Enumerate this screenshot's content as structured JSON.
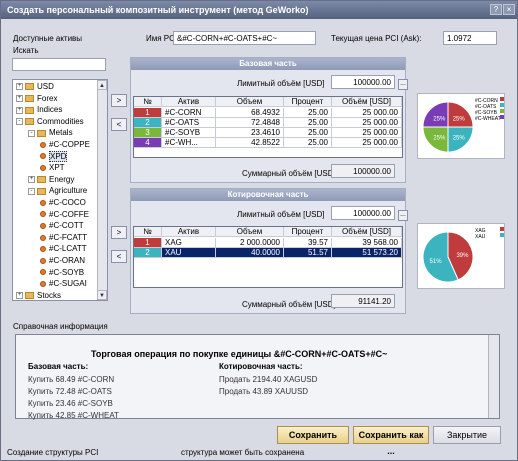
{
  "window": {
    "title": "Создать персональный композитный инструмент (метод GeWorko)"
  },
  "left": {
    "available_label": "Доступные активы",
    "search_label": "Искать",
    "search_value": "",
    "tree": [
      {
        "label": "USD",
        "level": 0,
        "kind": "folder",
        "exp": "+"
      },
      {
        "label": "Forex",
        "level": 0,
        "kind": "folder",
        "exp": "+"
      },
      {
        "label": "Indices",
        "level": 0,
        "kind": "folder",
        "exp": "+"
      },
      {
        "label": "Commodities",
        "level": 0,
        "kind": "folder",
        "exp": "-"
      },
      {
        "label": "Metals",
        "level": 1,
        "kind": "folder",
        "exp": "-"
      },
      {
        "label": "#C-COPPE",
        "level": 2,
        "kind": "item"
      },
      {
        "label": "XPD",
        "level": 2,
        "kind": "item",
        "selected": true
      },
      {
        "label": "XPT",
        "level": 2,
        "kind": "item"
      },
      {
        "label": "Energy",
        "level": 1,
        "kind": "folder",
        "exp": "+"
      },
      {
        "label": "Agriculture",
        "level": 1,
        "kind": "folder",
        "exp": "-"
      },
      {
        "label": "#C-COCO",
        "level": 2,
        "kind": "item"
      },
      {
        "label": "#C-COFFE",
        "level": 2,
        "kind": "item"
      },
      {
        "label": "#C-COTT",
        "level": 2,
        "kind": "item"
      },
      {
        "label": "#C-FCATT",
        "level": 2,
        "kind": "item"
      },
      {
        "label": "#C-LCATT",
        "level": 2,
        "kind": "item"
      },
      {
        "label": "#C-ORAN",
        "level": 2,
        "kind": "item"
      },
      {
        "label": "#C-SOYB",
        "level": 2,
        "kind": "item"
      },
      {
        "label": "#C-SUGAI",
        "level": 2,
        "kind": "item"
      },
      {
        "label": "Stocks",
        "level": 0,
        "kind": "folder",
        "exp": "+"
      }
    ]
  },
  "pci": {
    "name_label": "Имя PCI:",
    "name_value": "&#C-CORN+#C-OATS+#C~",
    "price_label": "Текущая цена PCI (Ask):",
    "price_value": "1.0972"
  },
  "base": {
    "title": "Базовая часть",
    "limit_label": "Лимитный объём [USD]",
    "limit_value": "100000.00",
    "sum_label": "Суммарный объём [USD]",
    "sum_value": "100000.00",
    "headers": [
      "№",
      "Актив",
      "Объем",
      "Процент",
      "Объём [USD]"
    ],
    "rows": [
      {
        "n": "1",
        "asset": "#C-CORN",
        "vol": "68.4932",
        "pct": "25.00",
        "usd": "25 000.00",
        "color": "#c03c3c"
      },
      {
        "n": "2",
        "asset": "#C-OATS",
        "vol": "72.4848",
        "pct": "25.00",
        "usd": "25 000.00",
        "color": "#3cb4c0"
      },
      {
        "n": "3",
        "asset": "#C-SOYB",
        "vol": "23.4610",
        "pct": "25.00",
        "usd": "25 000.00",
        "color": "#7ab83c"
      },
      {
        "n": "4",
        "asset": "#C-WH...",
        "vol": "42.8522",
        "pct": "25.00",
        "usd": "25 000.00",
        "color": "#7a3cb4"
      }
    ],
    "pie": {
      "legend": [
        "#C-CORN",
        "#C-OATS",
        "#C-SOYB",
        "#C-WHEAT"
      ],
      "values": [
        25,
        25,
        25,
        25
      ],
      "labels": [
        "25%",
        "25%",
        "25%",
        "25%"
      ]
    }
  },
  "quote": {
    "title": "Котировочная часть",
    "limit_label": "Лимитный объём [USD]",
    "limit_value": "100000.00",
    "sum_label": "Суммарный объём [USD]",
    "sum_value": "91141.20",
    "headers": [
      "№",
      "Актив",
      "Объем",
      "Процент",
      "Объём [USD]"
    ],
    "rows": [
      {
        "n": "1",
        "asset": "XAG",
        "vol": "2 000.0000",
        "pct": "39.57",
        "usd": "39 568.00",
        "color": "#c03c3c"
      },
      {
        "n": "2",
        "asset": "XAU",
        "vol": "40.0000",
        "pct": "51.57",
        "usd": "51 573.20",
        "color": "#3cb4c0",
        "selected": true
      }
    ],
    "pie": {
      "legend": [
        "XAG",
        "XAU"
      ],
      "values": [
        39,
        51
      ],
      "labels": [
        "39%",
        "51%"
      ]
    }
  },
  "info": {
    "label": "Справочная информация",
    "heading": "Торговая операция по покупке единицы &#C-CORN+#C-OATS+#C~",
    "base_title": "Базовая часть:",
    "base_lines": [
      "Купить 68.49 #C-CORN",
      "Купить 72.48 #C-OATS",
      "Купить 23.46 #C-SOYB",
      "Купить 42.85 #C-WHEAT"
    ],
    "quote_title": "Котировочная часть:",
    "quote_lines": [
      "Продать 2194.40 XAGUSD",
      "Продать 43.89 XAUUSD"
    ]
  },
  "buttons": {
    "save": "Сохранить",
    "save_as": "Сохранить как ...",
    "close": "Закрытие"
  },
  "status": {
    "left": "Создание структуры PCI",
    "right": "структура может быть сохранена"
  }
}
